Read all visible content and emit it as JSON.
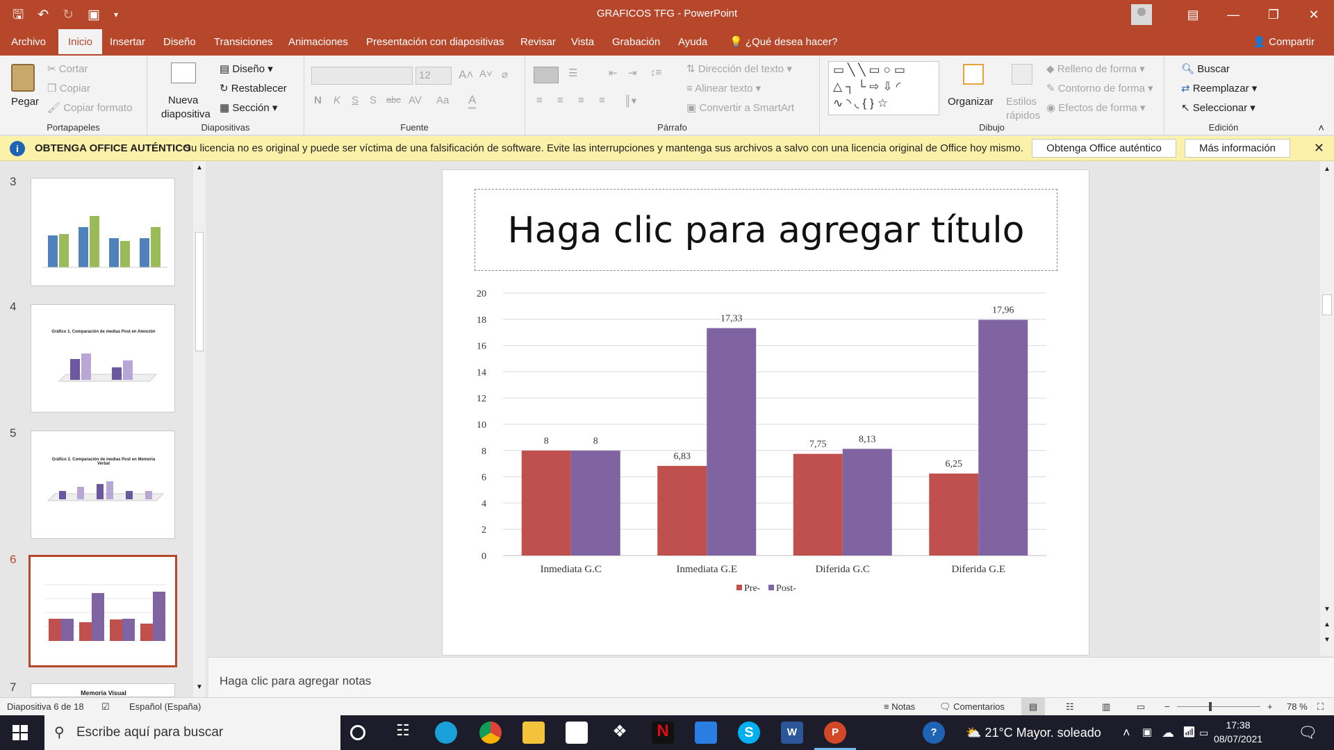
{
  "window": {
    "file_title": "GRAFICOS TFG",
    "separator": "-",
    "app_name": "PowerPoint"
  },
  "quick_access": {
    "icons": [
      "save-icon",
      "undo-icon",
      "redo-icon",
      "presenter-icon",
      "customize-icon"
    ]
  },
  "menu": {
    "tabs": [
      "Archivo",
      "Inicio",
      "Insertar",
      "Diseño",
      "Transiciones",
      "Animaciones",
      "Presentación con diapositivas",
      "Revisar",
      "Vista",
      "Grabación",
      "Ayuda"
    ],
    "active": "Inicio",
    "tell_me": "¿Qué desea hacer?",
    "share": "Compartir"
  },
  "ribbon": {
    "portapapeles": {
      "label": "Portapapeles",
      "paste": "Pegar",
      "cut": "Cortar",
      "copy": "Copiar",
      "format_painter": "Copiar formato"
    },
    "diapositivas": {
      "label": "Diapositivas",
      "new_slide_1": "Nueva",
      "new_slide_2": "diapositiva",
      "layout": "Diseño",
      "reset": "Restablecer",
      "section": "Sección"
    },
    "fuente": {
      "label": "Fuente",
      "font_name": "",
      "font_size": "12"
    },
    "parrafo": {
      "label": "Párrafo",
      "text_direction": "Dirección del texto",
      "align_text": "Alinear texto",
      "smartart": "Convertir a SmartArt"
    },
    "dibujo": {
      "label": "Dibujo",
      "arrange": "Organizar",
      "quick_styles_1": "Estilos",
      "quick_styles_2": "rápidos",
      "shape_fill": "Relleno de forma",
      "shape_outline": "Contorno de forma",
      "shape_effects": "Efectos de forma"
    },
    "edicion": {
      "label": "Edición",
      "find": "Buscar",
      "replace": "Reemplazar",
      "select": "Seleccionar"
    }
  },
  "infobar": {
    "title": "OBTENGA OFFICE AUTÉNTICO",
    "message": "Su licencia no es original y puede ser víctima de una falsificación de software. Evite las interrupciones y mantenga sus archivos a salvo con una licencia original de Office hoy mismo.",
    "btn_genuine": "Obtenga Office auténtico",
    "btn_more": "Más información"
  },
  "thumbnails": [
    {
      "number": "3",
      "selected": false
    },
    {
      "number": "4",
      "selected": false,
      "title": "Gráfico 1. Comparación de medias Post en Atención"
    },
    {
      "number": "5",
      "selected": false,
      "title": "Gráfico 2. Comparación de medias Post en Memoria Verbal"
    },
    {
      "number": "6",
      "selected": true
    },
    {
      "number": "7",
      "selected": false,
      "title": "Memoria Visual"
    }
  ],
  "slide": {
    "title_placeholder": "Haga clic para agregar título"
  },
  "chart_data": {
    "type": "bar",
    "categories": [
      "Inmediata G.C",
      "Inmediata G.E",
      "Diferida G.C",
      "Diferida G.E"
    ],
    "series": [
      {
        "name": "Pre-",
        "color": "#c0504d",
        "values": [
          8,
          6.83,
          7.75,
          6.25
        ],
        "labels": [
          "8",
          "6,83",
          "7,75",
          "6,25"
        ]
      },
      {
        "name": "Post-",
        "color": "#8064a2",
        "values": [
          8,
          17.33,
          8.13,
          17.96
        ],
        "labels": [
          "8",
          "17,33",
          "8,13",
          "17,96"
        ]
      }
    ],
    "title": "",
    "xlabel": "",
    "ylabel": "",
    "ylim": [
      0,
      20
    ],
    "yticks": [
      "0",
      "2",
      "4",
      "6",
      "8",
      "10",
      "12",
      "14",
      "16",
      "18",
      "20"
    ],
    "grid": true,
    "legend": "bottom"
  },
  "notes": {
    "placeholder": "Haga clic para agregar notas"
  },
  "status": {
    "slide_info": "Diapositiva 6 de 18",
    "language": "Español (España)",
    "notes": "Notas",
    "comments": "Comentarios",
    "zoom": "78 %"
  },
  "taskbar": {
    "search_placeholder": "Escribe aquí para buscar",
    "weather": "21°C  Mayor. soleado",
    "time": "17:38",
    "date": "08/07/2021"
  }
}
